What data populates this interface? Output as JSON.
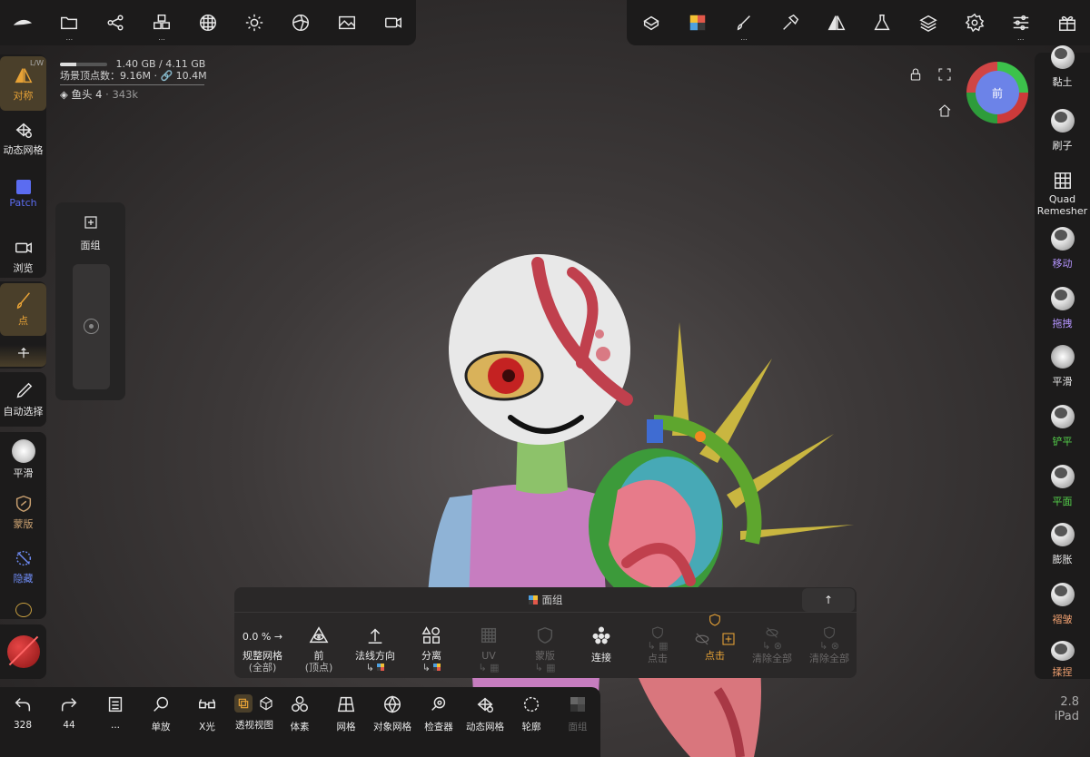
{
  "top_left_toolbar": {
    "items": [
      {
        "icon": "app-logo-icon"
      },
      {
        "icon": "folder-icon",
        "more": "..."
      },
      {
        "icon": "scene-graph-icon"
      },
      {
        "icon": "voxel-icon",
        "more": "..."
      },
      {
        "icon": "topology-icon"
      },
      {
        "icon": "light-icon"
      },
      {
        "icon": "shading-icon"
      },
      {
        "icon": "image-icon"
      },
      {
        "icon": "camera-icon"
      }
    ]
  },
  "top_right_toolbar": {
    "items": [
      {
        "icon": "mesh-icon"
      },
      {
        "icon": "material-swatch-icon"
      },
      {
        "icon": "paint-brush-icon",
        "more": "..."
      },
      {
        "icon": "hammer-icon"
      },
      {
        "icon": "symmetry-icon"
      },
      {
        "icon": "flask-icon"
      },
      {
        "icon": "layers-icon"
      },
      {
        "icon": "settings-gear-icon"
      },
      {
        "icon": "sliders-icon",
        "more": "..."
      },
      {
        "icon": "gift-icon"
      }
    ]
  },
  "stats": {
    "memory": "1.40 GB / 4.11 GB",
    "memory_fraction": 0.34,
    "scene_vertices": "场景顶点数：9.16M · 🔗 10.4M",
    "object_name": "鱼头 4",
    "object_vertices": "· 343k"
  },
  "left_tools": {
    "lw_tag": "L/W",
    "symmetry": "对称",
    "dynamic_mesh": "动态网格",
    "patch": "Patch",
    "view": "浏览",
    "point": "点",
    "auto_select": "自动选择",
    "smooth": "平滑",
    "mask": "蒙版",
    "hide": "隐藏"
  },
  "facegroup_popup": {
    "label": "面组"
  },
  "gizmo": {
    "face_label": "前"
  },
  "right_tools": {
    "clay": "黏土",
    "brush": "刷子",
    "quad_remesher": "Quad\nRemesher",
    "move": "移动",
    "drag": "拖拽",
    "smooth": "平滑",
    "flatten": "铲平",
    "plane": "平面",
    "inflate": "膨胀",
    "crease": "褶皱",
    "pinch": "揉捏"
  },
  "sub_panel": {
    "title": "面组",
    "up_arrow": "↑",
    "buttons": [
      {
        "value": "0.0 % →",
        "label": "规整网格",
        "sub": "(全部)"
      },
      {
        "label": "前",
        "sub": "(顶点)"
      },
      {
        "label": "法线方向",
        "more": "..."
      },
      {
        "label": "分离"
      },
      {
        "label": "UV"
      },
      {
        "label": "蒙版"
      },
      {
        "label": "连接"
      },
      {
        "label": "点击"
      },
      {
        "label": "点击"
      },
      {
        "label": "清除全部"
      },
      {
        "label": "清除全部"
      }
    ]
  },
  "bottom_toolbar": {
    "undo_count": "328",
    "redo_count": "44",
    "more": "...",
    "zoom": "单放",
    "xray": "X光",
    "perspective": "透视视图",
    "voxel": "体素",
    "wireframe": "网格",
    "object_mesh": "对象网格",
    "inspector": "检查器",
    "dynamic_mesh": "动态网格",
    "outline": "轮廓",
    "face_group": "面组"
  },
  "version": {
    "number": "2.8",
    "platform": "iPad"
  },
  "colors": {
    "accent_orange": "#e7a236",
    "accent_blue": "#5b6cf0",
    "accent_green": "#55d24b",
    "accent_purple": "#b595ff",
    "accent_peach": "#f0a070"
  }
}
